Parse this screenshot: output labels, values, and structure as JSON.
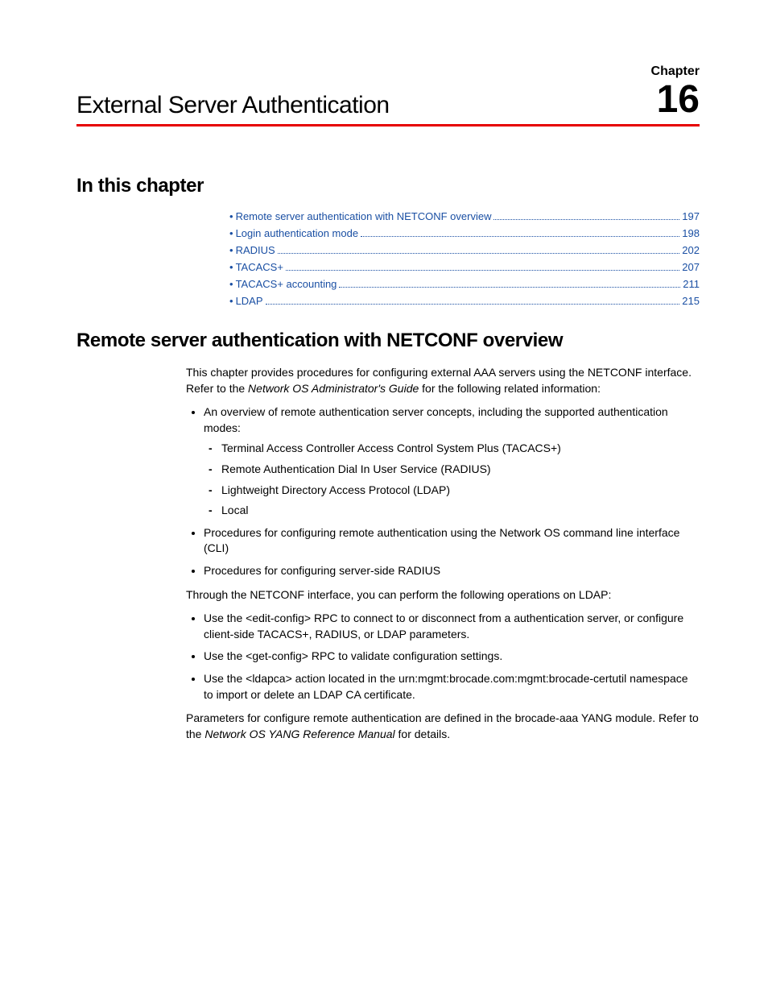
{
  "header": {
    "chapter_label": "Chapter",
    "chapter_title": "External Server Authentication",
    "chapter_number": "16"
  },
  "sections": {
    "in_this_chapter": "In this chapter",
    "remote_overview": "Remote server authentication with NETCONF overview"
  },
  "toc": [
    {
      "label": "Remote server authentication with NETCONF overview",
      "page": "197"
    },
    {
      "label": "Login authentication mode",
      "page": "198"
    },
    {
      "label": "RADIUS",
      "page": "202"
    },
    {
      "label": "TACACS+",
      "page": "207"
    },
    {
      "label": "TACACS+ accounting",
      "page": "211"
    },
    {
      "label": "LDAP",
      "page": "215"
    }
  ],
  "body": {
    "intro_pre": "This chapter provides procedures for configuring external AAA servers using the NETCONF interface. Refer to the ",
    "intro_em": "Network OS Administrator's Guide",
    "intro_post": " for the following related information:",
    "list1_item1": "An overview of remote authentication server concepts, including the supported authentication modes:",
    "modes": [
      "Terminal Access Controller Access Control System Plus (TACACS+)",
      "Remote Authentication Dial In User Service  (RADIUS)",
      "Lightweight Directory Access Protocol (LDAP)",
      "Local"
    ],
    "list1_item2": "Procedures for configuring remote authentication using the Network OS command line interface (CLI)",
    "list1_item3": "Procedures for configuring server-side RADIUS",
    "netconf_intro": "Through the NETCONF interface, you can perform the following operations on LDAP:",
    "list2_item1": "Use the <edit-config> RPC to connect to or disconnect from a authentication server, or configure client-side TACACS+, RADIUS, or LDAP parameters.",
    "list2_item2": "Use the <get-config> RPC to validate configuration settings.",
    "list2_item3": "Use the <ldapca> action located in the urn:mgmt:brocade.com:mgmt:brocade-certutil namespace to import or delete an LDAP CA certificate.",
    "closing_pre": "Parameters for configure remote authentication are defined in the brocade-aaa YANG module. Refer to the ",
    "closing_em": "Network OS YANG Reference Manual",
    "closing_post": " for details."
  }
}
